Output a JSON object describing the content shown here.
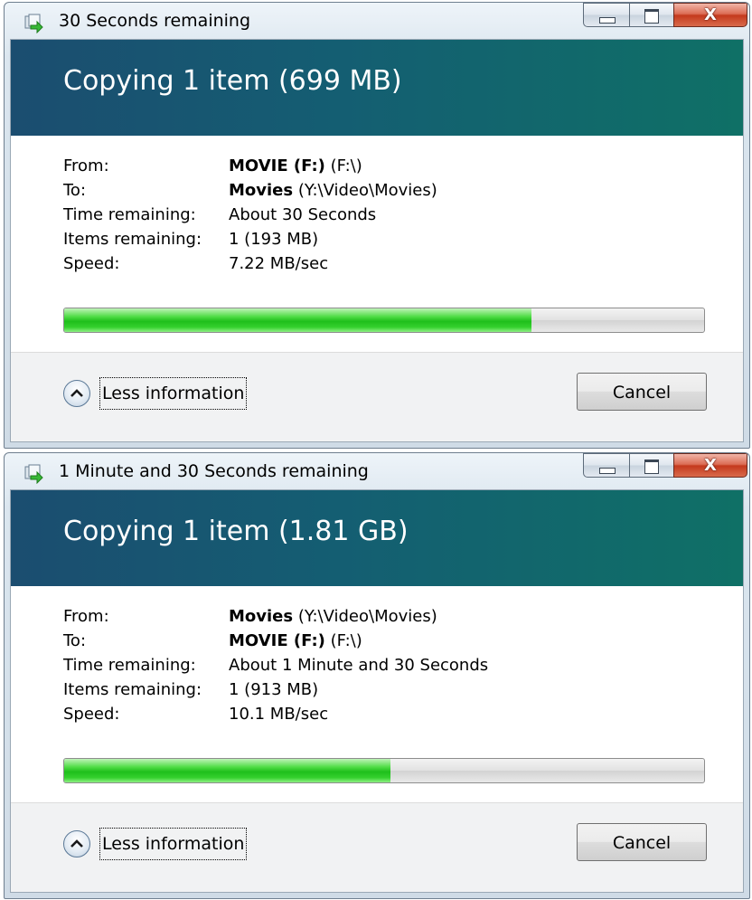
{
  "colors": {
    "header_gradient_start": "#1b4d70",
    "header_gradient_end": "#0f7066",
    "progress_green": "#1fbf1c",
    "close_button_red": "#c4391d"
  },
  "icons": {
    "app": "copy-arrow-icon",
    "minimize": "minimize-icon",
    "maximize": "maximize-icon",
    "close": "close-icon",
    "less_info": "chevron-up-circle-icon"
  },
  "dialogs": [
    {
      "window_title": "30 Seconds remaining",
      "close_glyph": "X",
      "header": "Copying 1 item (699 MB)",
      "labels": {
        "from": "From:",
        "to": "To:",
        "time": "Time remaining:",
        "items": "Items remaining:",
        "speed": "Speed:"
      },
      "from_name": "MOVIE (F:)",
      "from_path": " (F:\\)",
      "to_name": "Movies",
      "to_path": " (Y:\\Video\\Movies)",
      "time_remaining": "About 30 Seconds",
      "items_remaining": "1 (193 MB)",
      "speed": "7.22 MB/sec",
      "progress_percent": 73,
      "less_info_label": "Less information",
      "cancel_label": "Cancel"
    },
    {
      "window_title": "1 Minute and 30 Seconds remaining",
      "close_glyph": "X",
      "header": "Copying 1 item (1.81 GB)",
      "labels": {
        "from": "From:",
        "to": "To:",
        "time": "Time remaining:",
        "items": "Items remaining:",
        "speed": "Speed:"
      },
      "from_name": "Movies",
      "from_path": " (Y:\\Video\\Movies)",
      "to_name": "MOVIE (F:)",
      "to_path": " (F:\\)",
      "time_remaining": "About 1 Minute and 30 Seconds",
      "items_remaining": "1 (913 MB)",
      "speed": "10.1 MB/sec",
      "progress_percent": 51,
      "less_info_label": "Less information",
      "cancel_label": "Cancel"
    }
  ]
}
